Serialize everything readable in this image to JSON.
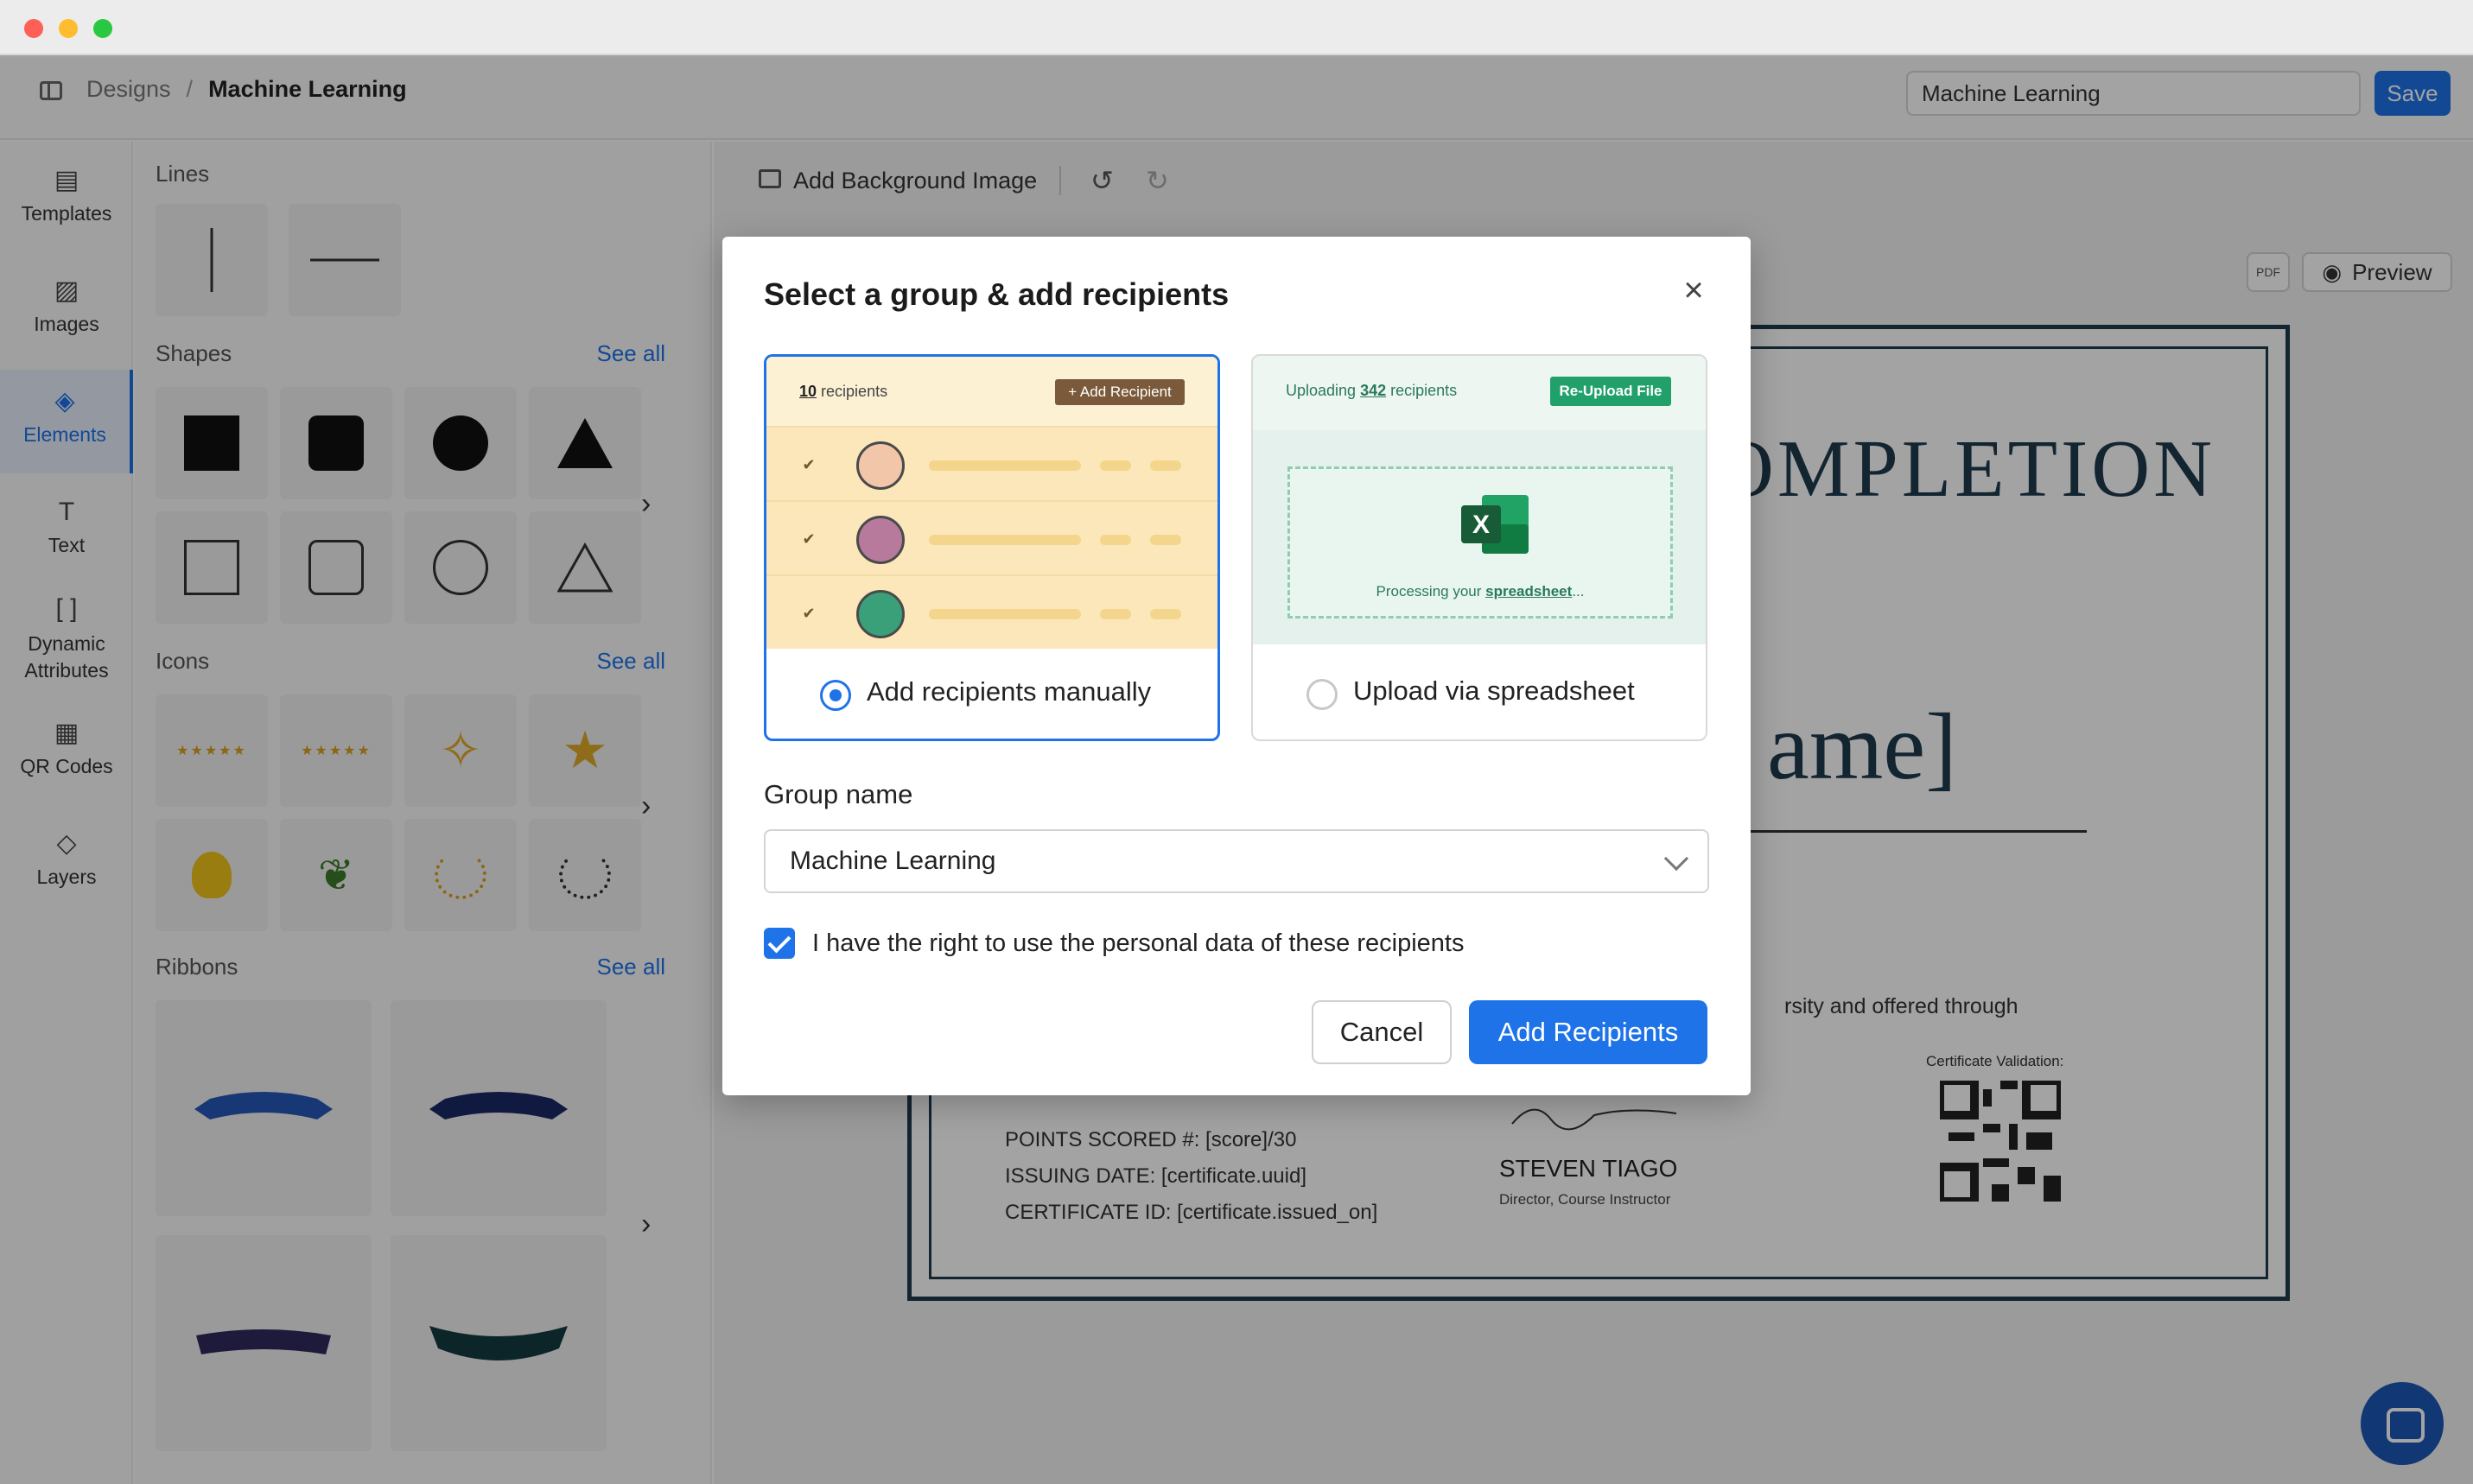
{
  "header": {
    "breadcrumb_root": "Designs",
    "breadcrumb_sep": "/",
    "breadcrumb_current": "Machine Learning",
    "design_name_value": "Machine Learning",
    "save_label": "Save"
  },
  "rail": {
    "items": [
      {
        "label": "Templates",
        "icon": "templates-icon"
      },
      {
        "label": "Images",
        "icon": "image-icon"
      },
      {
        "label": "Elements",
        "icon": "elements-icon"
      },
      {
        "label": "Text",
        "icon": "text-icon"
      },
      {
        "label": "Dynamic Attributes",
        "icon": "brackets-icon"
      },
      {
        "label": "QR Codes",
        "icon": "qr-icon"
      },
      {
        "label": "Layers",
        "icon": "layers-icon"
      }
    ],
    "active": "Elements"
  },
  "panel": {
    "lines_title": "Lines",
    "shapes_title": "Shapes",
    "icons_title": "Icons",
    "ribbons_title": "Ribbons",
    "see_all": "See all",
    "chevron": "›"
  },
  "canvas": {
    "add_background_label": "Add Background Image",
    "preview_label": "Preview",
    "pdf_label": "PDF",
    "certificate": {
      "heading": "OMPLETION",
      "name_placeholder": "ame]",
      "offered_text": "rsity and offered through",
      "validation_label": "Certificate Validation:",
      "points": "POINTS SCORED #: [score]/30",
      "issuing_date": "ISSUING DATE: [certificate.uuid]",
      "certificate_id": "CERTIFICATE ID: [certificate.issued_on]",
      "signer_name": "STEVEN TIAGO",
      "signer_title": "Director, Course Instructor"
    }
  },
  "modal": {
    "title": "Select a group & add recipients",
    "close_symbol": "×",
    "manual": {
      "count_number": "10",
      "count_suffix": "recipients",
      "add_recipient_label": "+ Add Recipient",
      "label": "Add recipients manually",
      "selected": true
    },
    "spreadsheet": {
      "uploading_prefix": "Uploading",
      "uploading_number": "342",
      "uploading_suffix": "recipients",
      "reupload_label": "Re-Upload File",
      "processing_prefix": "Processing your",
      "processing_link": "spreadsheet",
      "processing_suffix": "...",
      "label": "Upload via spreadsheet",
      "selected": false
    },
    "group_name_label": "Group name",
    "group_name_value": "Machine Learning",
    "consent_text": "I have the right to use the personal data of these recipients",
    "consent_checked": true,
    "cancel_label": "Cancel",
    "add_label": "Add Recipients"
  },
  "colors": {
    "accent": "#1e73e8",
    "manual_bg": "#fdf1d4",
    "sheet_bg": "#e4f1ec",
    "sheet_accent": "#22a06b",
    "certificate_ink": "#1f3b4d"
  }
}
